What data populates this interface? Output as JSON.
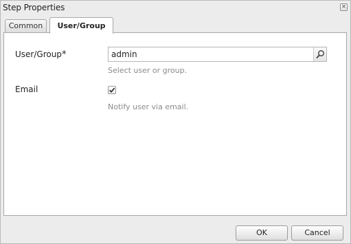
{
  "window": {
    "title": "Step Properties",
    "close_glyph": "×",
    "close_icon": "close-icon"
  },
  "tabs": [
    {
      "label": "Common",
      "active": false
    },
    {
      "label": "User/Group",
      "active": true
    }
  ],
  "form": {
    "user_group": {
      "label": "User/Group",
      "required_mark": "*",
      "value": "admin",
      "hint": "Select user or group.",
      "trigger_icon": "search-icon"
    },
    "email": {
      "label": "Email",
      "checked": true,
      "hint": "Notify user via email.",
      "check_icon": "checkmark-icon"
    }
  },
  "buttons": {
    "ok": "OK",
    "cancel": "Cancel"
  }
}
